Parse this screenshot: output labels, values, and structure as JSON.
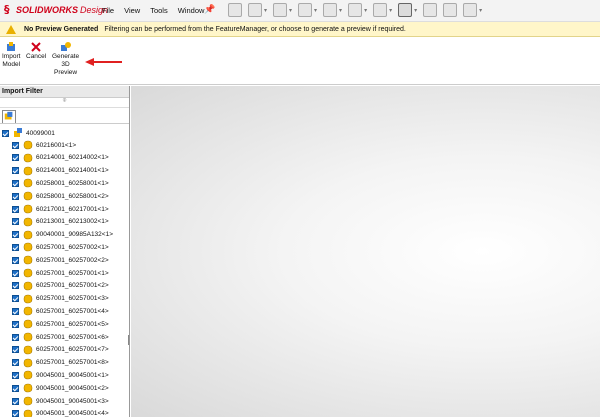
{
  "app": {
    "logo_mark": "§",
    "logo_brand": "SOLIDWORKS",
    "logo_sub": "Design"
  },
  "menu": [
    "File",
    "View",
    "Tools",
    "Window"
  ],
  "warning": {
    "title": "No Preview Generated",
    "message": "Filtering can be performed from the FeatureManager, or choose to generate a preview if required."
  },
  "ribbon": {
    "import_label_1": "Import",
    "import_label_2": "Model",
    "cancel_label": "Cancel",
    "generate_label_1": "Generate",
    "generate_label_2": "3D",
    "generate_label_3": "Preview"
  },
  "panel": {
    "title": "Import Filter",
    "root": "40099001",
    "items": [
      "60216001<1>",
      "60214001_60214002<1>",
      "60214001_60214001<1>",
      "60258001_60258001<1>",
      "60258001_60258001<2>",
      "60217001_60217001<1>",
      "60213001_60213002<1>",
      "90040001_90985A132<1>",
      "60257001_60257002<1>",
      "60257001_60257002<2>",
      "60257001_60257001<1>",
      "60257001_60257001<2>",
      "60257001_60257001<3>",
      "60257001_60257001<4>",
      "60257001_60257001<5>",
      "60257001_60257001<6>",
      "60257001_60257001<7>",
      "60257001_60257001<8>",
      "90045001_90045001<1>",
      "90045001_90045001<2>",
      "90045001_90045001<3>",
      "90045001_90045001<4>"
    ]
  },
  "colors": {
    "brand": "#d0021b",
    "warning_bg": "#fff6c9",
    "checkbox": "#1d6fc7",
    "arrow": "#e02020"
  }
}
